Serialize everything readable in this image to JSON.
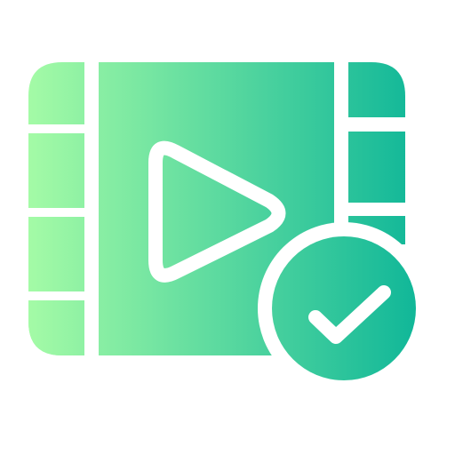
{
  "icon": {
    "name": "video-verified-icon",
    "gradient_start": "#a4fba6",
    "gradient_end": "#0cb598",
    "background": "#ffffff",
    "stroke": "#ffffff"
  }
}
